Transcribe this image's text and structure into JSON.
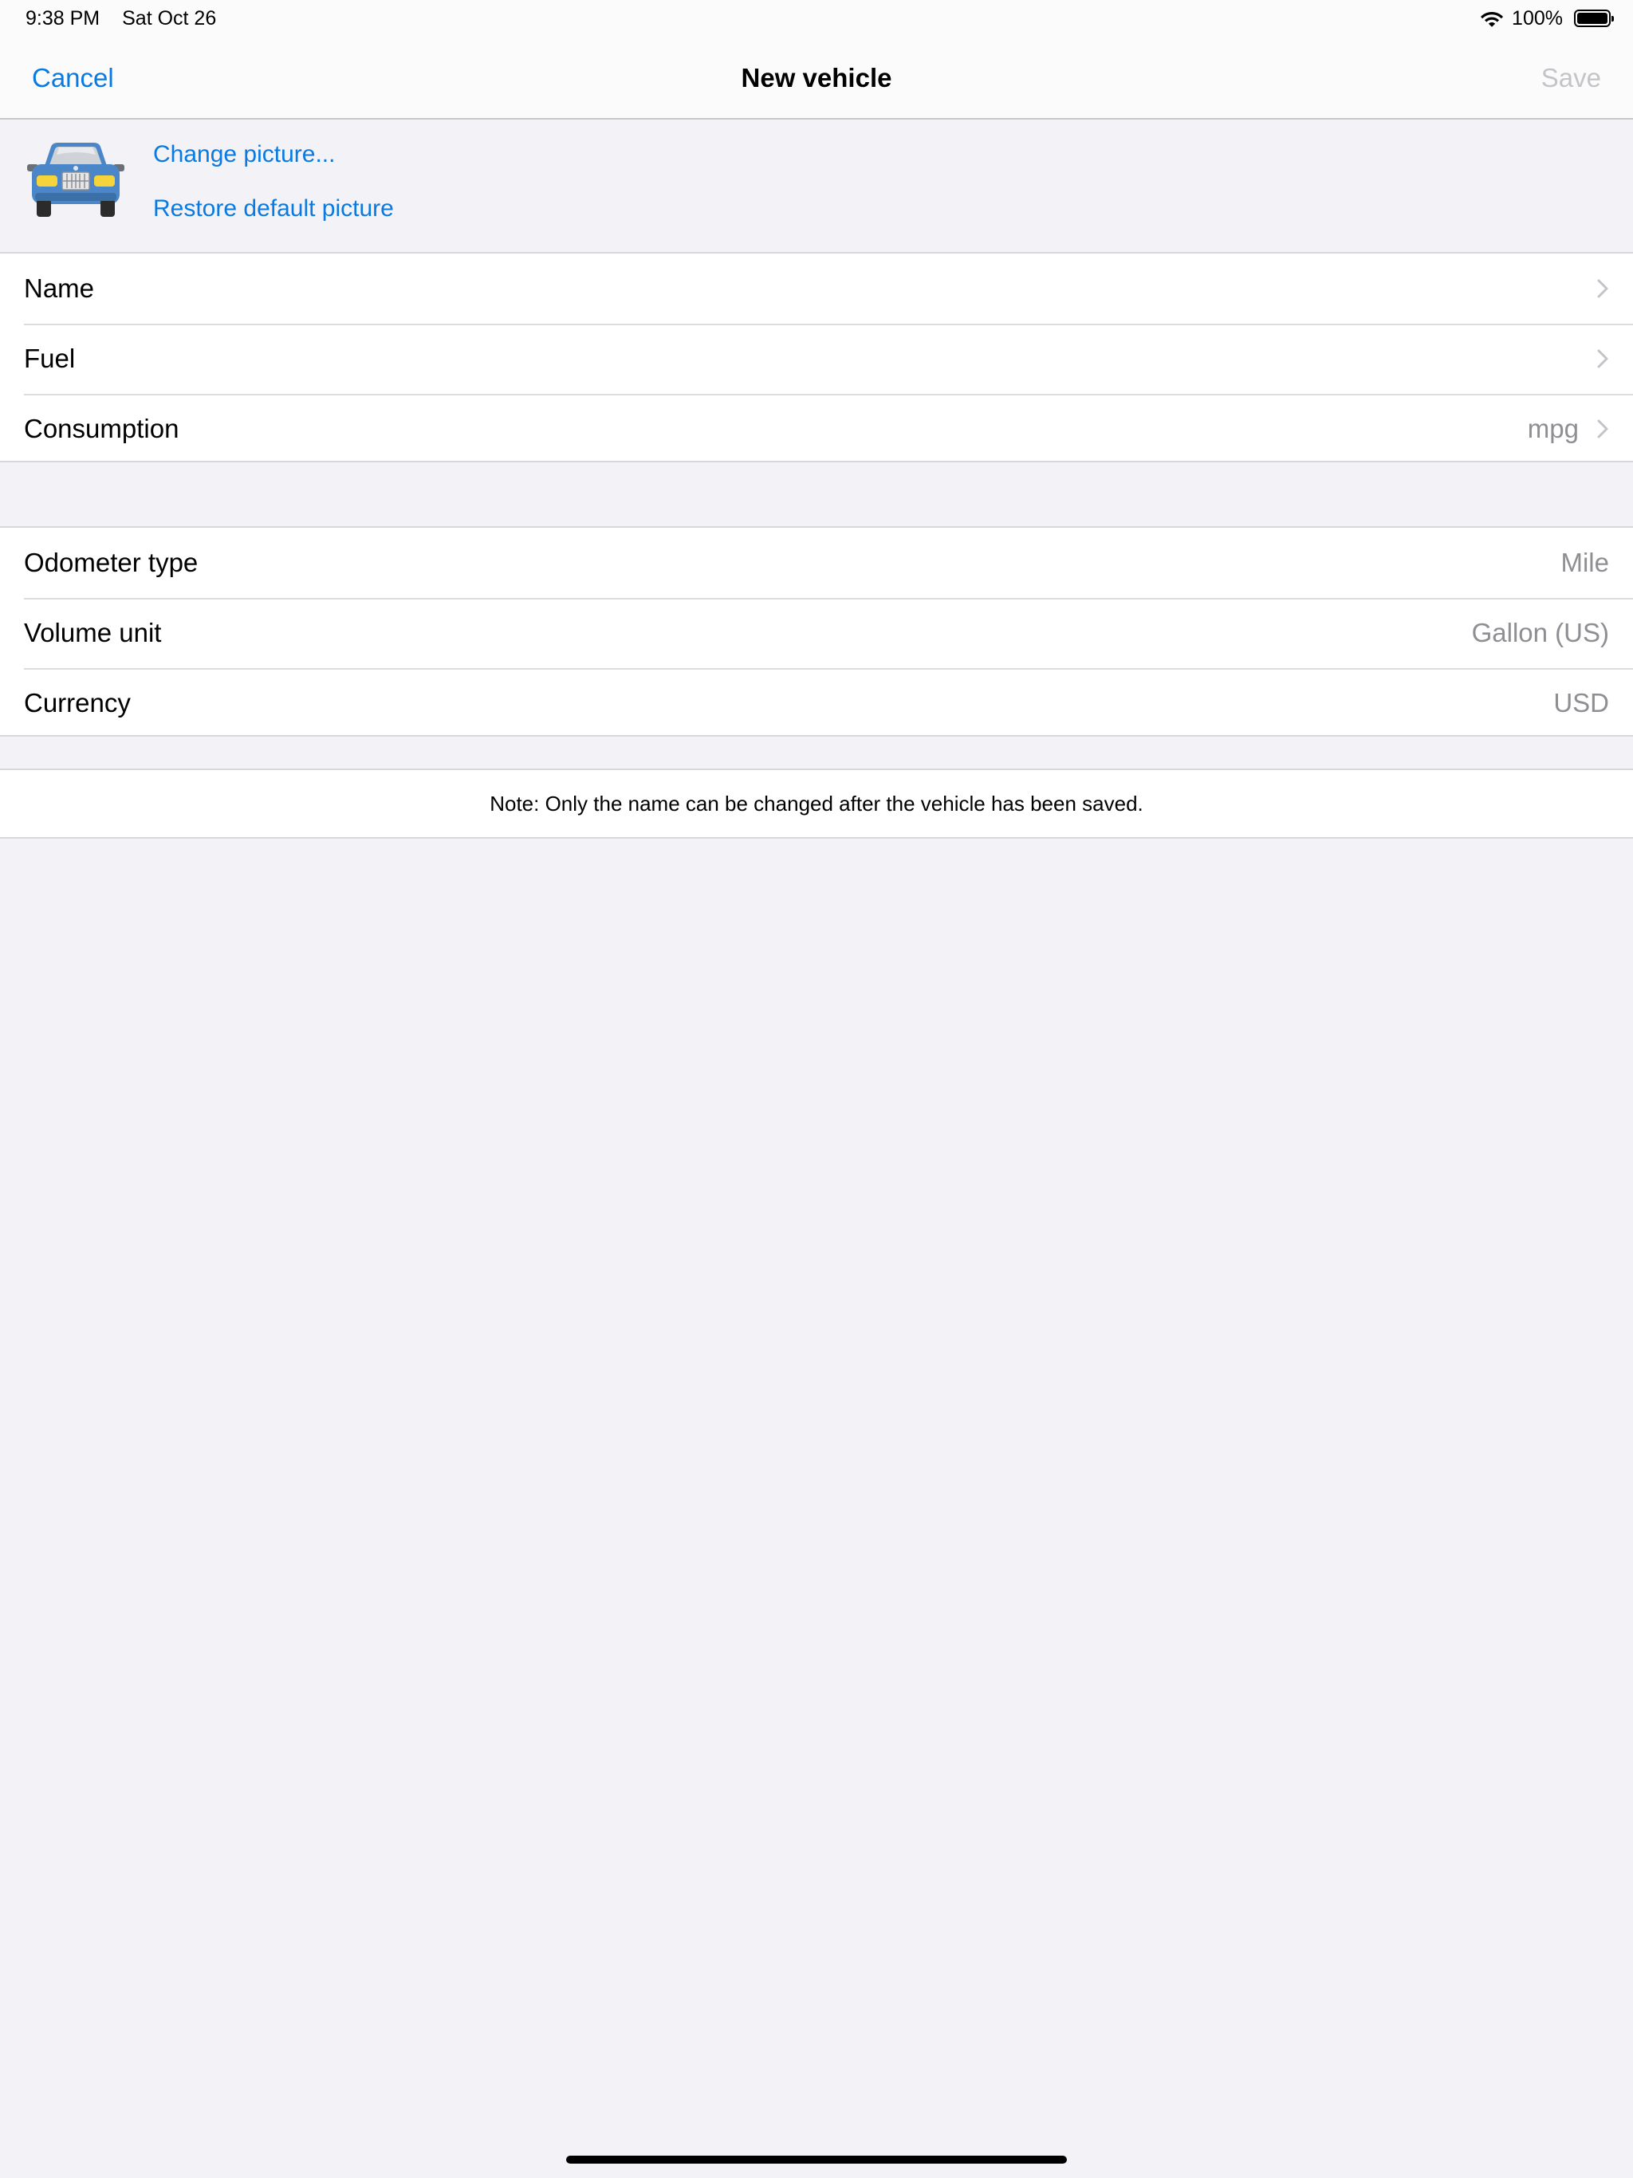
{
  "status_bar": {
    "time": "9:38 PM",
    "date": "Sat Oct 26",
    "battery_percent": "100%",
    "icons": [
      "wifi-icon",
      "battery-icon"
    ]
  },
  "nav": {
    "cancel_label": "Cancel",
    "title": "New vehicle",
    "save_label": "Save"
  },
  "picture": {
    "icon": "car-icon",
    "change_label": "Change picture...",
    "restore_label": "Restore default picture"
  },
  "details": {
    "rows": [
      {
        "label": "Name",
        "value": ""
      },
      {
        "label": "Fuel",
        "value": ""
      },
      {
        "label": "Consumption",
        "value": "mpg"
      }
    ]
  },
  "units": {
    "rows": [
      {
        "label": "Odometer type",
        "value": "Mile"
      },
      {
        "label": "Volume unit",
        "value": "Gallon (US)"
      },
      {
        "label": "Currency",
        "value": "USD"
      }
    ]
  },
  "note": "Note: Only the name can be changed after the vehicle has been saved.",
  "colors": {
    "accent": "#0a7ae0",
    "disabled": "#c4c4c8",
    "secondary_text": "#8e8e93",
    "background": "#f2f2f7",
    "car_body": "#4a86c8",
    "headlights": "#f5d33a"
  }
}
